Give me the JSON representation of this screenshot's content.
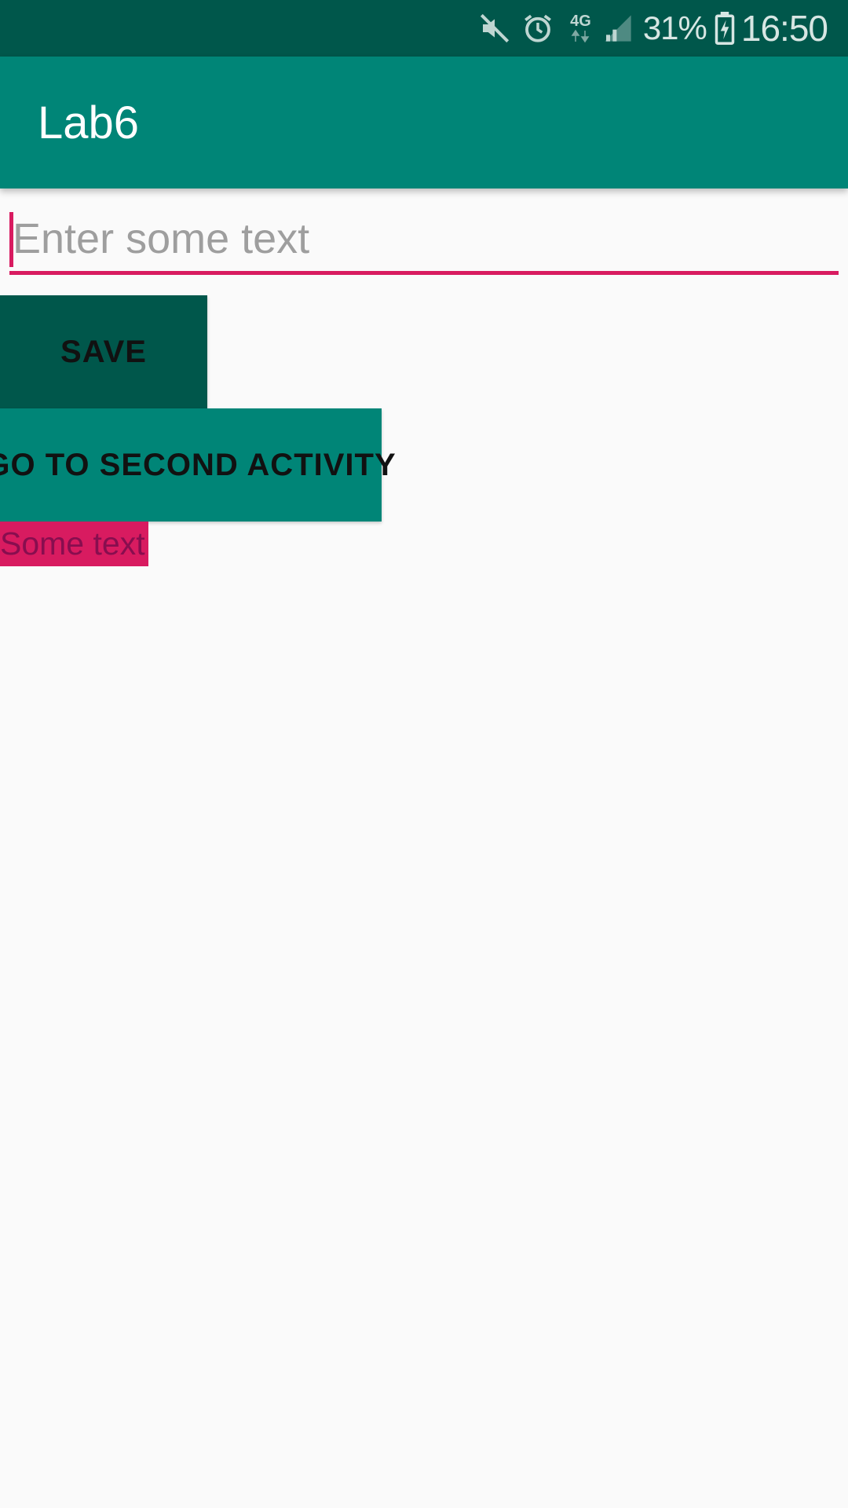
{
  "status_bar": {
    "icons": [
      "mute-icon",
      "alarm-icon",
      "4g-data-icon",
      "signal-icon",
      "battery-icon"
    ],
    "network_label": "4G",
    "battery_percent": "31%",
    "time": "16:50",
    "background": "#00574B"
  },
  "app_bar": {
    "title": "Lab6",
    "background": "#008577"
  },
  "text_input": {
    "value": "",
    "placeholder": "Enter some text",
    "accent": "#D81B60"
  },
  "buttons": {
    "save_label": "SAVE",
    "second_activity_label": "GO TO SECOND ACTIVITY"
  },
  "output": {
    "text": "Some text",
    "background": "#D81B60"
  }
}
